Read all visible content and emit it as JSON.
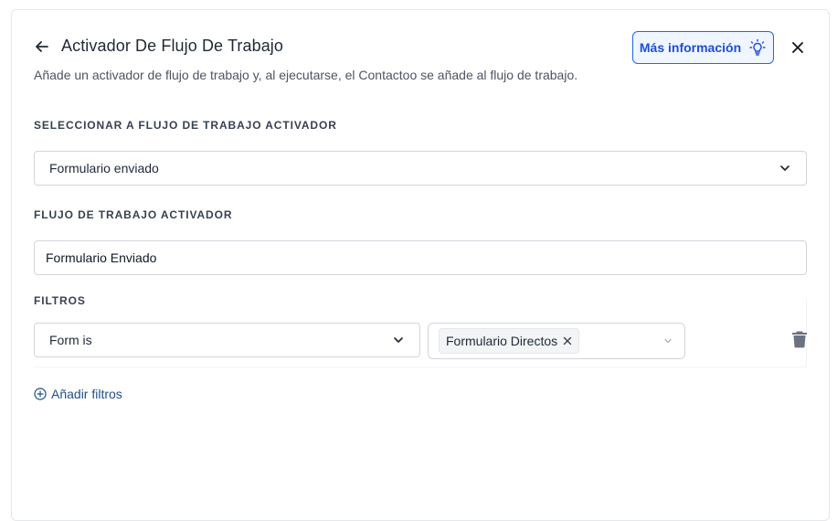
{
  "header": {
    "title": "Activador De Flujo De Trabajo",
    "subtitle": "Añade un activador de flujo de trabajo y, al ejecutarse, el Contactoo se añade al flujo de trabajo.",
    "info_button_label": "Más información",
    "icons": {
      "back": "arrow-left-icon",
      "info": "lightbulb-icon",
      "close": "close-icon"
    }
  },
  "trigger_select": {
    "label": "SELECCIONAR A FLUJO DE TRABAJO ACTIVADOR",
    "value": "Formulario enviado"
  },
  "trigger_name": {
    "label": "FLUJO DE TRABAJO ACTIVADOR",
    "value": "Formulario Enviado"
  },
  "filters": {
    "label": "FILTROS",
    "items": [
      {
        "field": "Form is",
        "values": [
          "Formulario Directos"
        ]
      }
    ],
    "add_label": "Añadir filtros"
  },
  "colors": {
    "accent": "#2563eb",
    "accent_bg": "#eff6ff",
    "link": "#1e4f8a",
    "border": "#d1d5db",
    "trash": "#6b7280"
  }
}
